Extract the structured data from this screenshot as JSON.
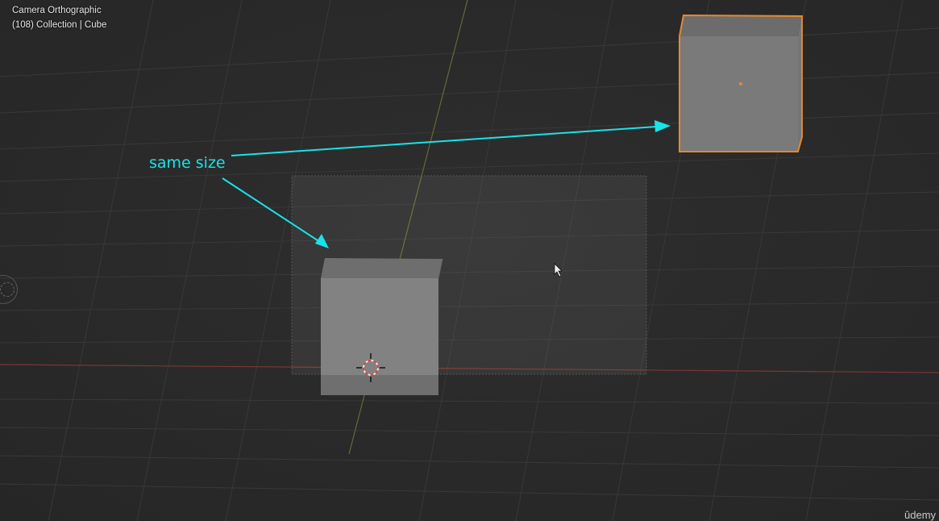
{
  "viewport": {
    "view_label": "Camera Orthographic",
    "collection_label": "(108) Collection | Cube"
  },
  "annotation": {
    "text": "same size",
    "color": "#19e3e8"
  },
  "watermark": "ûdemy",
  "colors": {
    "background": "#2b2b2b",
    "grid": "#363636",
    "x_axis": "#8a3a3a",
    "y_axis": "#6f7a3a",
    "selection_outline": "#e8872e",
    "cube_front": "#838383",
    "cube_top": "#6f6f6f"
  },
  "icons": {
    "cursor": "mouse-pointer-icon",
    "cursor_3d": "3d-cursor-icon",
    "gizmo": "view-gizmo-icon"
  }
}
